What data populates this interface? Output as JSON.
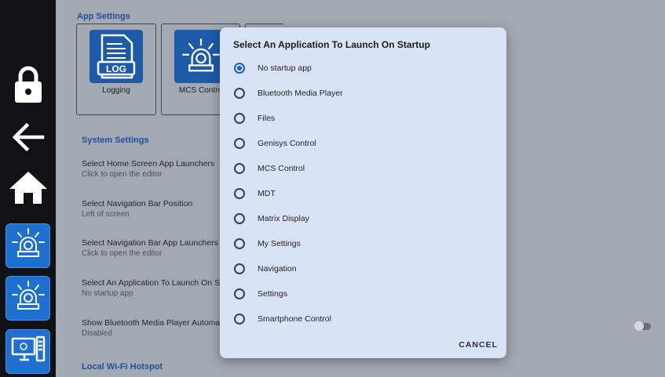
{
  "nav": {
    "items": [
      {
        "name": "lock-icon"
      },
      {
        "name": "back-arrow-icon"
      },
      {
        "name": "home-icon"
      },
      {
        "name": "alarm-beacon-icon"
      },
      {
        "name": "alarm-beacon-icon"
      },
      {
        "name": "computer-monitor-icon"
      }
    ]
  },
  "settings": {
    "app_settings_title": "App Settings",
    "apps": [
      {
        "label": "Logging",
        "icon": "log-file-icon",
        "icon_text": "LOG"
      },
      {
        "label": "MCS Contro",
        "icon": "alarm-beacon-icon"
      }
    ],
    "system_settings_title": "System Settings",
    "rows": [
      {
        "title": "Select Home Screen App Launchers",
        "subtitle": "Click to open the editor"
      },
      {
        "title": "Select Navigation Bar Position",
        "subtitle": "Left of screen"
      },
      {
        "title": "Select Navigation Bar App Launchers",
        "subtitle": "Click to open the editor"
      },
      {
        "title": "Select An Application To Launch On S",
        "subtitle": "No startup app"
      },
      {
        "title": "Show Bluetooth Media Player Automa",
        "subtitle": "Disabled"
      }
    ],
    "hotspot_title": "Local Wi-Fi Hotspot",
    "toggle_on": false
  },
  "dialog": {
    "title": "Select An Application To Launch On Startup",
    "options": [
      "No startup app",
      "Bluetooth Media Player",
      "Files",
      "Genisys Control",
      "MCS Control",
      "MDT",
      "Matrix Display",
      "My Settings",
      "Navigation",
      "Settings",
      "Smartphone Control"
    ],
    "selected_index": 0,
    "cancel_label": "CANCEL"
  },
  "colors": {
    "accent": "#1a5fc8",
    "nav_bg": "#111215",
    "tile_blue": "#1d6fd0",
    "dialog_bg": "#d9e3f6"
  }
}
